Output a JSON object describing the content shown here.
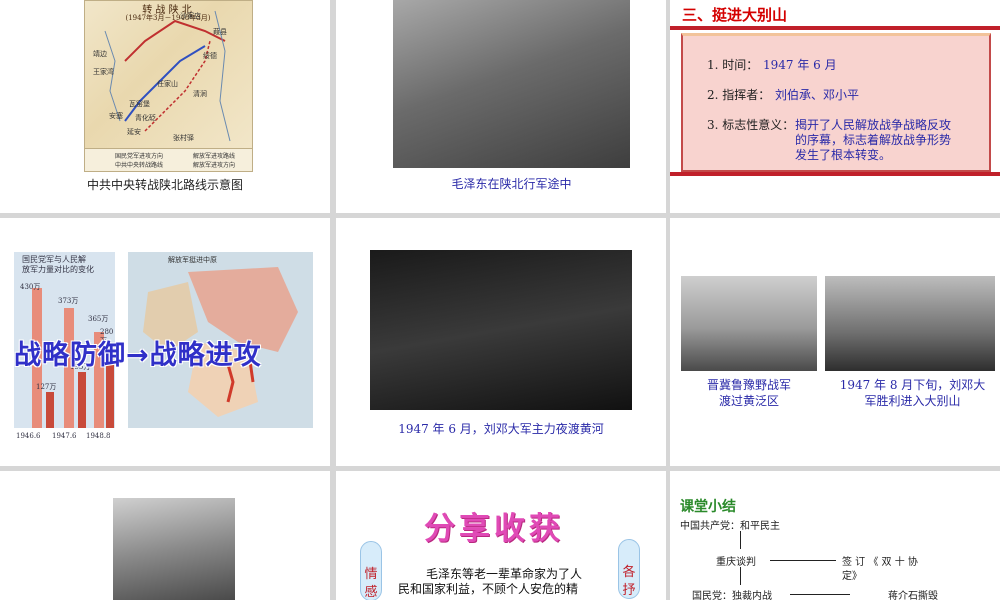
{
  "slides": {
    "s1": {
      "map_title": "转 战 陕 北",
      "map_subtitle": "(1947年3月－1948年3月)",
      "places": [
        "沙家店",
        "葭县",
        "绥德",
        "靖边",
        "王家湾",
        "任家山",
        "清涧",
        "安塞",
        "延安",
        "瓦窑堡",
        "青化砭",
        "张村驿"
      ],
      "legend": [
        "国民党军进攻方向",
        "中共中央转战路线",
        "解放军进攻路线",
        "解放军进攻方向"
      ],
      "caption": "中共中央转战陕北路线示意图"
    },
    "s2": {
      "caption": "毛泽东在陕北行军途中"
    },
    "s3": {
      "heading": "三、挺进大别山",
      "rows": [
        {
          "label": "1. 时间：",
          "value": "1947 年 6 月"
        },
        {
          "label": "2. 指挥者：",
          "value": "刘伯承、邓小平"
        },
        {
          "label": "3. 标志性意义：",
          "value1": "揭开了人民解放战争战略反攻",
          "value2": "的序幕，标志着解放战争形势",
          "value3": "发生了根本转变。"
        }
      ]
    },
    "s4": {
      "chart_title1": "国民党军与人民解",
      "chart_title2": "放军力量对比的变化",
      "labels": [
        "430万",
        "373万",
        "365万",
        "280万",
        "195万",
        "127万",
        "1946.6",
        "1947.6",
        "1948.8"
      ],
      "map_title": "解放军挺进中原",
      "big_text": "战略防御→战略进攻"
    },
    "s5": {
      "caption": "1947 年 6 月，刘邓大军主力夜渡黄河"
    },
    "s6": {
      "caption_left1": "晋冀鲁豫野战军",
      "caption_left2": "渡过黄泛区",
      "caption_right1": "1947 年 8 月下旬，刘邓大",
      "caption_right2": "军胜利进入大别山"
    },
    "s8": {
      "title": "分享收获",
      "left_oval": "情感",
      "right_oval": "各抒",
      "text1": "毛泽东等老一辈革命家为了人",
      "text2": "民和国家利益，不顾个人安危的精"
    },
    "s9": {
      "heading": "课堂小结",
      "line1": "中国共产党：和平民主",
      "line2": "重庆谈判",
      "line3": "签 订 《 双 十 协",
      "line4": "定》",
      "line5": "国民党：独裁内战",
      "line6": "蒋介石撕毁"
    }
  },
  "colors": {
    "accent_red": "#d40000",
    "caption_blue": "#2a2aa8",
    "title_pink": "#e04ab6",
    "box_pink": "#f8d3cf"
  }
}
